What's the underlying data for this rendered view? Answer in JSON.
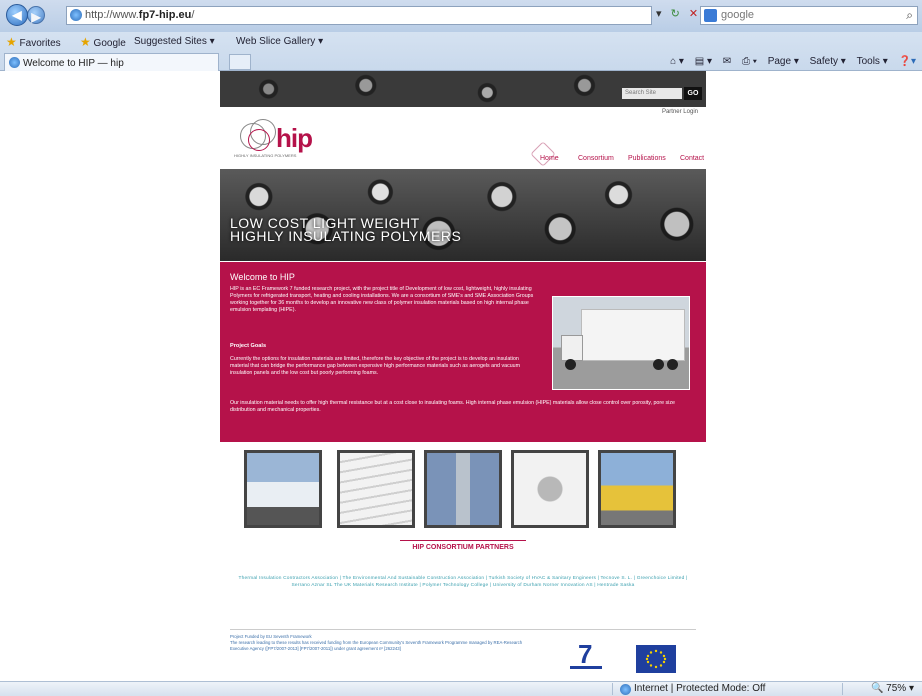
{
  "browser": {
    "url_prefix": "http://www.",
    "url_domain": "fp7-hip.eu",
    "url_suffix": "/",
    "search_text": "google",
    "favorites_label": "Favorites",
    "fav_google": "Google",
    "fav_suggested": "Suggested Sites ▾",
    "fav_webslice": "Web Slice Gallery ▾",
    "tab_title": "Welcome to HIP — hip",
    "cmd_page": "Page ▾",
    "cmd_safety": "Safety ▾",
    "cmd_tools": "Tools ▾"
  },
  "site": {
    "search_placeholder": "Search Site",
    "go": "GO",
    "login": "Partner Login",
    "logo_word": "hip",
    "logo_tagline": "HIGHLY INSULATING POLYMERS",
    "menu": [
      "Home",
      "Consortium",
      "Publications",
      "Contact"
    ],
    "banner_line1": "LOW COST LIGHT WEIGHT",
    "banner_line2": "HIGHLY INSULATING POLYMERS",
    "welcome_title": "Welcome to HIP",
    "intro": "HIP is an EC Framework 7 funded research project, with the project title of Development of low cost, lightweight, highly insulating Polymers for refrigerated transport, heating and cooling installations. We are a consortium of SME's and SME Association Groups working together for 36 months to develop an innovative new class of polymer insulation materials based on high internal phase emulsion templating (HIPE).",
    "goals_title": "Project Goals",
    "goals": "Currently the options for insulation materials are limited, therefore the key objective of the project is to develop an insulation material that can bridge the performance gap between expensive high performance materials such as aerogels and vacuum insulation panels and the low cost but poorly performing foams.",
    "insulation": "Our insulation material needs to offer high thermal resistance but at a cost close to insulating foams. High internal phase emulsion (HIPE) materials allow close control over porosity, pore size distribution and mechanical properties.",
    "partners_title": "HIP CONSORTIUM PARTNERS",
    "partners": "Thermal Insulation Contractors Association | The Environmental And Sustainable Construction Association | Turkish Society of HVAC & Sanitary Engineers | Tecnove S. L. | Greenchoice Limited | Serrano Aznar SL The UK Materials Research Institute | Polymer Technology College | University of Durham Norner Innovation AS | Hentrade Saska",
    "footer_line1": "Project Funded by EU Seventh Framework",
    "footer_line2": "The research leading to these results has received funding from the European Community's Seventh Framework Programme managed by REA-Research Executive Agency ([FP7/2007-2013] [FP7/2007-2011]) under grant agreement nº [262243]"
  },
  "status": {
    "zone": "Internet | Protected Mode: Off",
    "zoom": "75%"
  }
}
